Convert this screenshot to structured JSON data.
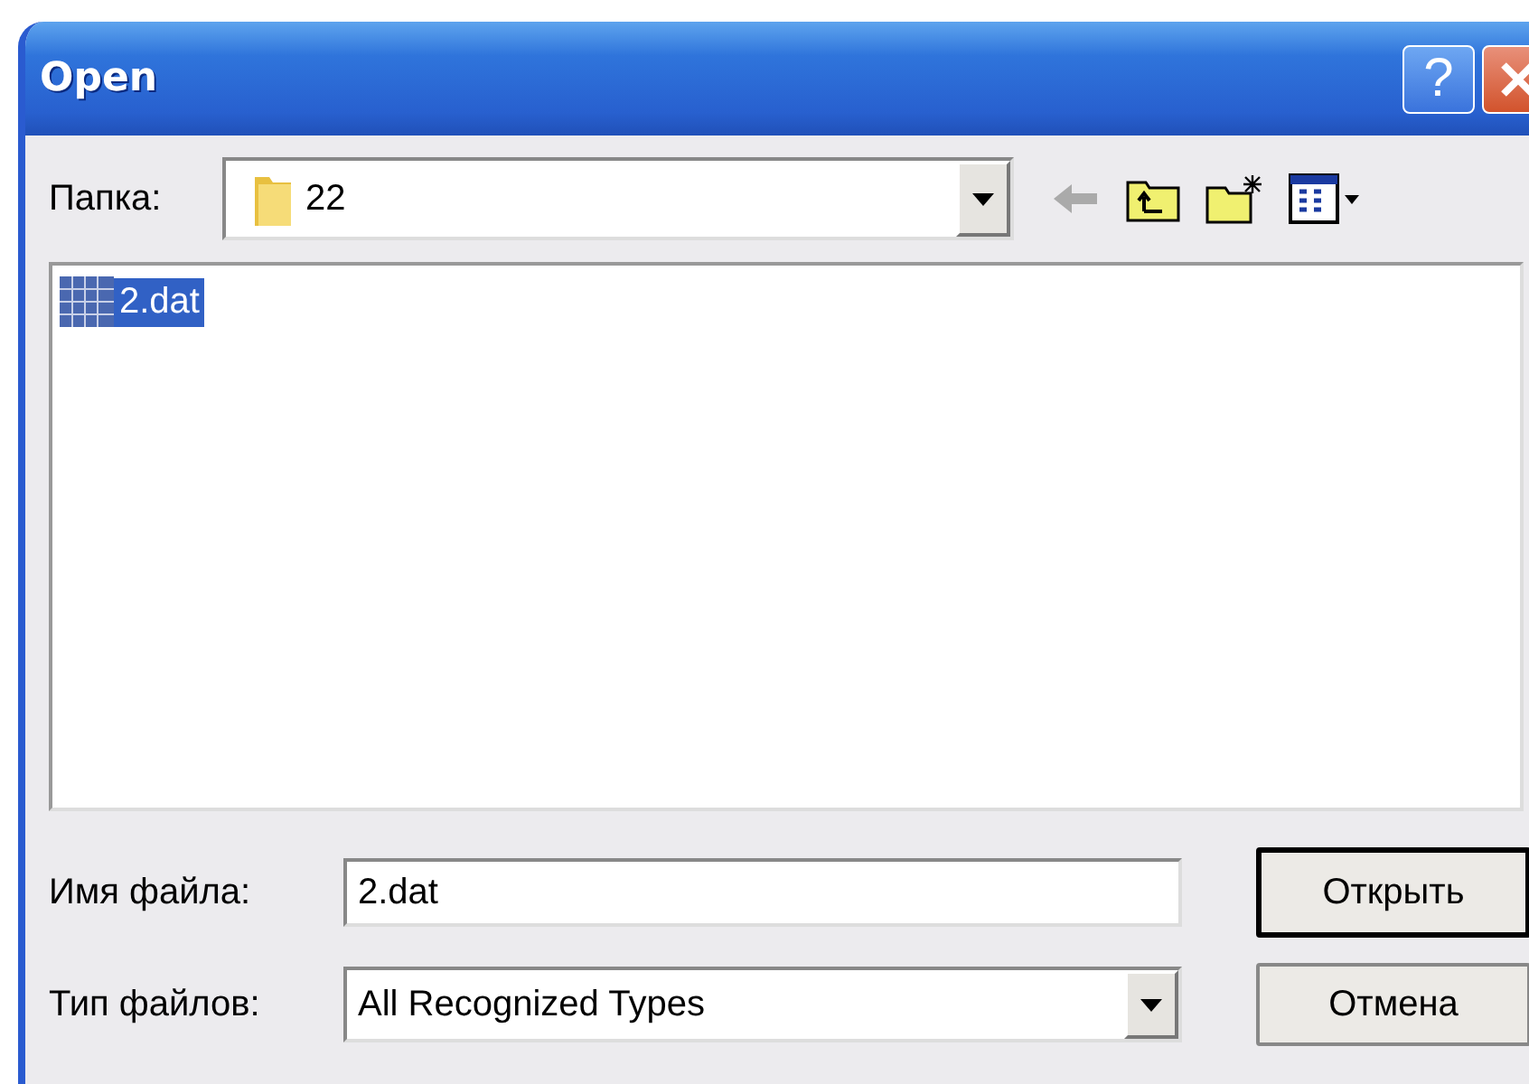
{
  "window": {
    "title": "Open",
    "help_button": "?"
  },
  "folder": {
    "label": "Папка:",
    "value": "22"
  },
  "files": [
    {
      "name": "2.dat",
      "selected": true
    }
  ],
  "file_name": {
    "label": "Имя файла:",
    "value": "2.dat"
  },
  "file_type": {
    "label": "Тип файлов:",
    "value": "All Recognized Types"
  },
  "buttons": [
    {
      "label": "Открыть",
      "default": true
    },
    {
      "label": "Отмена",
      "default": false
    }
  ]
}
